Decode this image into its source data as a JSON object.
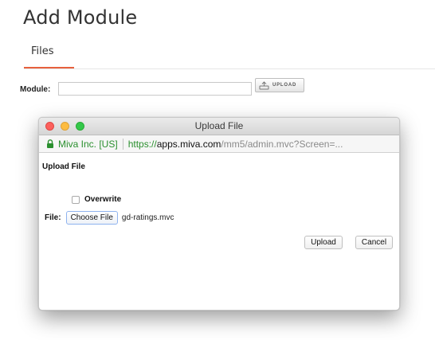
{
  "page": {
    "title": "Add Module"
  },
  "tabs": [
    {
      "label": "Files",
      "active": true
    }
  ],
  "module_field": {
    "label": "Module:",
    "value": "",
    "upload_label": "UPLOAD",
    "upload_icon": "upload-tray-icon"
  },
  "dialog": {
    "window_title": "Upload File",
    "url_bar": {
      "lock_icon": "lock-icon",
      "certificate": "Miva Inc. [US]",
      "scheme": "https://",
      "domain": "apps.miva.com",
      "path": "/mm5/admin.mvc?Screen=..."
    },
    "heading": "Upload File",
    "overwrite": {
      "label": "Overwrite",
      "checked": false
    },
    "file": {
      "label": "File:",
      "choose_label": "Choose File",
      "selected_name": "gd-ratings.mvc"
    },
    "buttons": {
      "upload": "Upload",
      "cancel": "Cancel"
    }
  },
  "colors": {
    "tab_accent": "#e7603d",
    "secure_green": "#2a8f2e",
    "traffic_red": "#fc605c",
    "traffic_yellow": "#fdbc40",
    "traffic_green": "#34c84a"
  }
}
